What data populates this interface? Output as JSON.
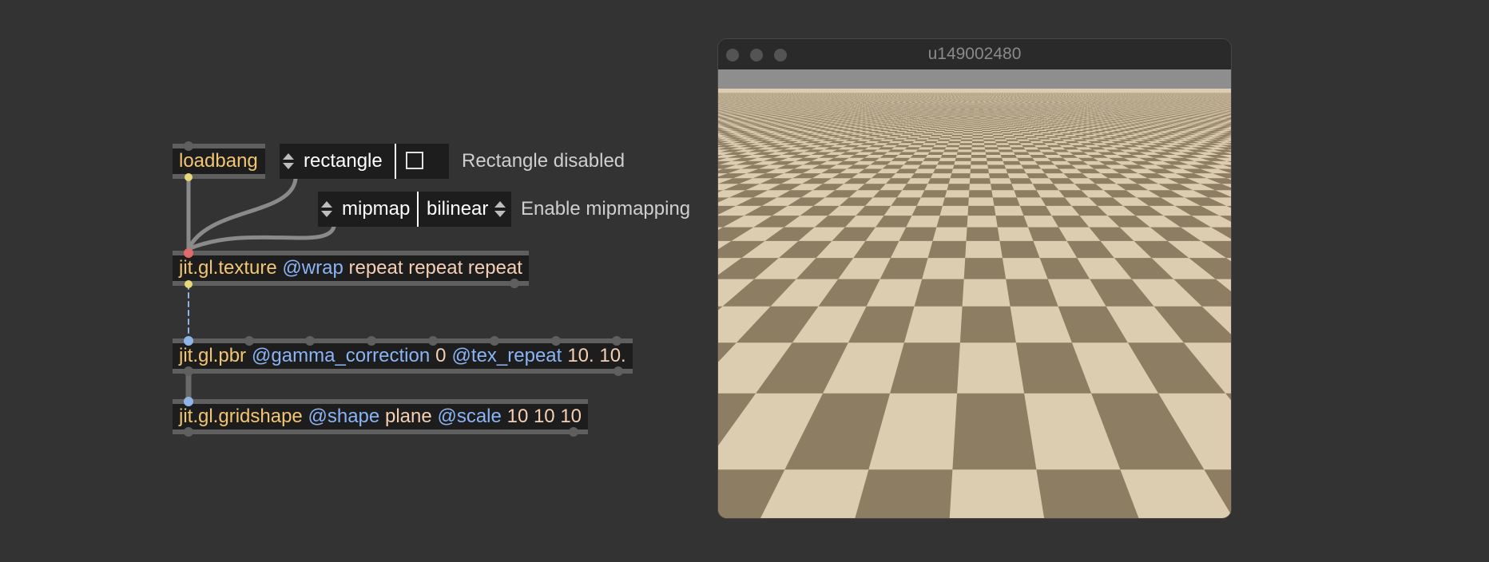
{
  "patcher": {
    "loadbang": {
      "label": "loadbang"
    },
    "rectangle_menu": {
      "label": "rectangle"
    },
    "rectangle_toggle": {
      "checked": false
    },
    "rectangle_comment": "Rectangle disabled",
    "mipmap_menu": {
      "label": "mipmap"
    },
    "filter_menu": {
      "label": "bilinear"
    },
    "mipmap_comment": "Enable mipmapping",
    "texture": {
      "class": "jit.gl.texture",
      "attr1": "@wrap",
      "val1": "repeat repeat repeat"
    },
    "pbr": {
      "class": "jit.gl.pbr",
      "attr1": "@gamma_correction",
      "val1": "0",
      "attr2": "@tex_repeat",
      "val2": "10. 10."
    },
    "gridshape": {
      "class": "jit.gl.gridshape",
      "attr1": "@shape",
      "val1": "plane",
      "attr2": "@scale",
      "val2": "10 10 10"
    }
  },
  "render_window": {
    "title": "u149002480",
    "scene": {
      "checker_light": "#dccdb0",
      "checker_dark": "#8c7d63",
      "sky": "#8e8e8e"
    }
  }
}
